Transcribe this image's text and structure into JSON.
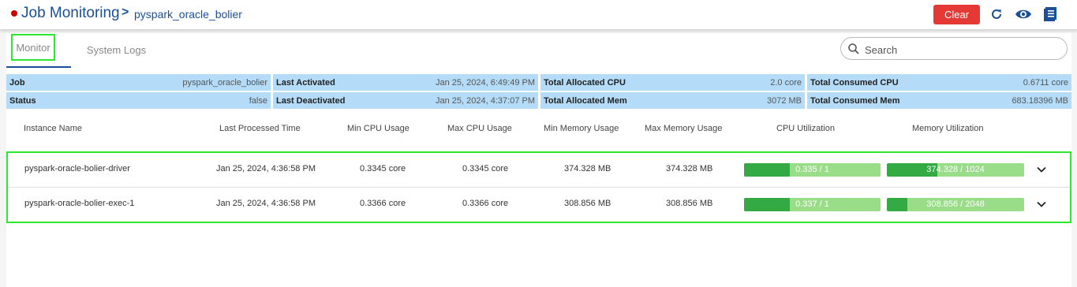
{
  "header": {
    "title": "Job Monitoring",
    "breadcrumb_separator": ">",
    "job_name": "pyspark_oracle_bolier",
    "clear_label": "Clear",
    "status_color": "#cc0000",
    "icons": [
      "refresh-icon",
      "eye-icon",
      "log-book-icon"
    ]
  },
  "tabs": [
    {
      "label": "Monitor",
      "active": true
    },
    {
      "label": "System Logs",
      "active": false
    }
  ],
  "search": {
    "placeholder": "Search"
  },
  "summary": {
    "job_label": "Job",
    "job_value": "pyspark_oracle_bolier",
    "status_label": "Status",
    "status_value": "false",
    "last_activated_label": "Last Activated",
    "last_activated_value": "Jan 25, 2024, 6:49:49 PM",
    "last_deactivated_label": "Last Deactivated",
    "last_deactivated_value": "Jan 25, 2024, 4:37:07 PM",
    "alloc_cpu_label": "Total Allocated CPU",
    "alloc_cpu_value": "2.0 core",
    "alloc_mem_label": "Total Allocated Mem",
    "alloc_mem_value": "3072 MB",
    "consumed_cpu_label": "Total Consumed CPU",
    "consumed_cpu_value": "0.6711 core",
    "consumed_mem_label": "Total Consumed Mem",
    "consumed_mem_value": "683.18396 MB"
  },
  "table": {
    "columns": [
      "Instance Name",
      "Last Processed Time",
      "Min CPU Usage",
      "Max CPU Usage",
      "Min Memory Usage",
      "Max Memory Usage",
      "CPU Utilization",
      "Memory Utilization"
    ],
    "rows": [
      {
        "instance": "pyspark-oracle-bolier-driver",
        "last_processed": "Jan 25, 2024, 4:36:58 PM",
        "min_cpu": "0.3345 core",
        "max_cpu": "0.3345 core",
        "min_mem": "374.328 MB",
        "max_mem": "374.328 MB",
        "cpu_util_text": "0.335 / 1",
        "cpu_util_fraction": 0.335,
        "mem_util_text": "374.328 / 1024",
        "mem_util_fraction": 0.3655
      },
      {
        "instance": "pyspark-oracle-bolier-exec-1",
        "last_processed": "Jan 25, 2024, 4:36:58 PM",
        "min_cpu": "0.3366 core",
        "max_cpu": "0.3366 core",
        "min_mem": "308.856 MB",
        "max_mem": "308.856 MB",
        "cpu_util_text": "0.337 / 1",
        "cpu_util_fraction": 0.337,
        "mem_util_text": "308.856 / 2048",
        "mem_util_fraction": 0.1508
      }
    ]
  },
  "colors": {
    "accent": "#1a4f9a",
    "clear": "#e53935",
    "summary_bg": "#b4dcf8",
    "bar_fill": "#33aa44",
    "bar_track": "#99dd88",
    "highlight": "#2ee82e"
  }
}
